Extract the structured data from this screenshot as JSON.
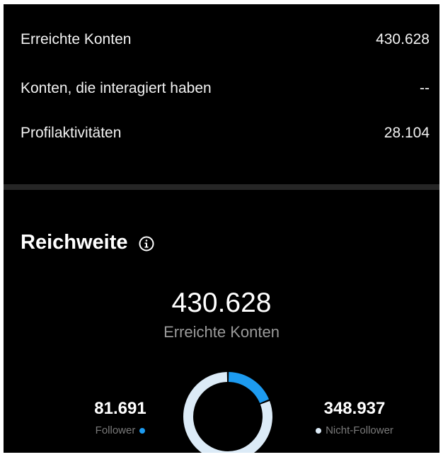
{
  "metrics": [
    {
      "label": "Erreichte Konten",
      "value": "430.628"
    },
    {
      "label": "Konten, die interagiert haben",
      "value": "--"
    },
    {
      "label": "Profilaktivitäten",
      "value": "28.104"
    }
  ],
  "reach": {
    "title": "Reichweite",
    "info_icon": "info-icon",
    "total": "430.628",
    "total_label": "Erreichte Konten",
    "followers": {
      "value": "81.691",
      "label": "Follower",
      "color": "#1d9bf0"
    },
    "non_followers": {
      "value": "348.937",
      "label": "Nicht-Follower",
      "color": "#dcebf7"
    }
  },
  "chart_data": {
    "type": "pie",
    "categories": [
      "Follower",
      "Nicht-Follower"
    ],
    "values": [
      81691,
      348937
    ],
    "colors": [
      "#1d9bf0",
      "#dcebf7"
    ]
  }
}
